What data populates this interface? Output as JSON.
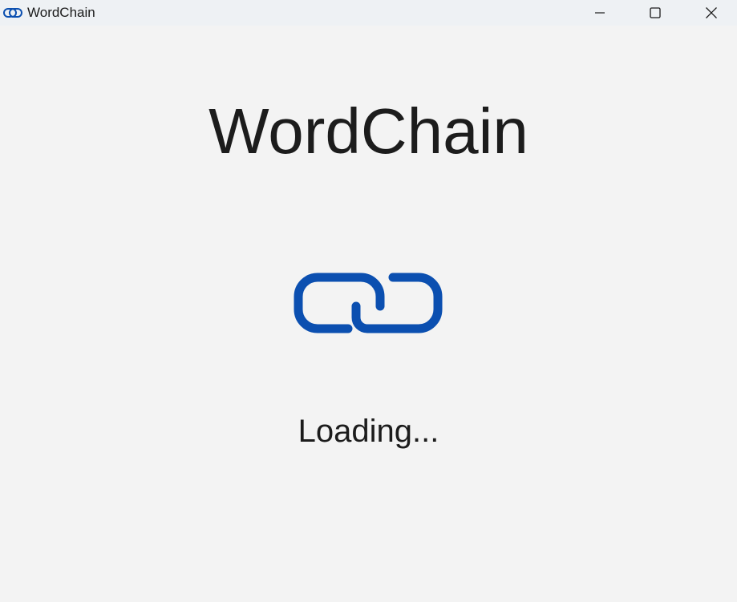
{
  "window": {
    "title": "WordChain",
    "controls": {
      "minimize_icon": "minimize-icon",
      "maximize_icon": "maximize-icon",
      "close_icon": "close-icon"
    }
  },
  "splash": {
    "heading": "WordChain",
    "logo_icon": "chain-link-icon",
    "status": "Loading..."
  },
  "colors": {
    "accent": "#0b4fb0",
    "background": "#f3f3f3",
    "titlebar": "#eef1f4",
    "text": "#1c1c1c"
  }
}
